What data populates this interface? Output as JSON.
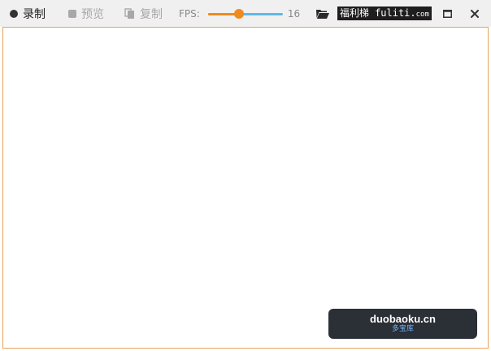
{
  "toolbar": {
    "record_label": "录制",
    "preview_label": "预览",
    "copy_label": "复制",
    "fps_label": "FPS:",
    "fps_value": "16",
    "fps_slider_fraction": 0.42,
    "open_folder_icon": "folder-open-icon",
    "watermark": {
      "cjk": "福利梯",
      "domain": "fuliti.",
      "tld": "com"
    }
  },
  "window_controls": {
    "maximize_icon": "maximize-icon",
    "close_icon": "close-icon"
  },
  "badge": {
    "main": "duobaoku.cn",
    "sub": "多宝库"
  },
  "colors": {
    "accent_orange": "#f08a1c",
    "slider_blue": "#5eb9e6",
    "canvas_border": "#e8a25a",
    "badge_bg": "#2b2f36"
  }
}
